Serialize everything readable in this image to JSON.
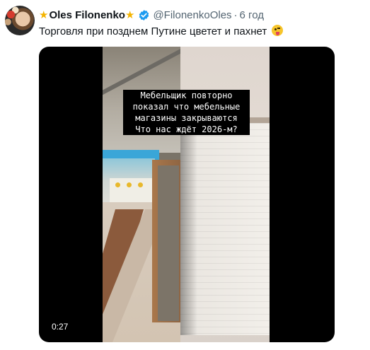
{
  "author": {
    "name": "Oles Filonenko",
    "handle": "@FilonenkoOles",
    "separator": "·",
    "time": "6 год"
  },
  "icons": {
    "leading": "star-icon",
    "trailing": "star-icon",
    "verified": "verified-badge-icon",
    "emoji": "zany-face-emoji"
  },
  "post": {
    "text": "Торговля при позднем Путине цветет и пахнет"
  },
  "video": {
    "caption": [
      "Мебельщик повторно",
      "показал что мебельные",
      "магазины закрываются",
      "Что нас ждёт 2026-м?"
    ],
    "duration": "0:27"
  },
  "colors": {
    "verified_badge": "#1d9bf0",
    "star": "#f4b400",
    "secondary_text": "#536471"
  }
}
